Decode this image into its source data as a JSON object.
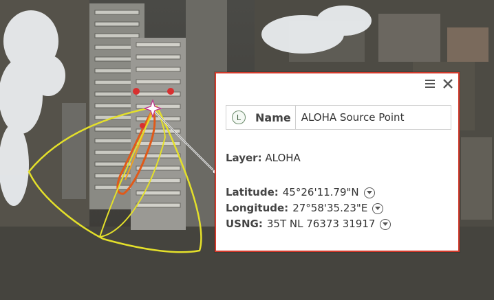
{
  "popup": {
    "menu_icon": "hamburger-menu-icon",
    "close_icon": "close-icon",
    "name_icon_letter": "L",
    "name_label": "Name",
    "name_value": "ALOHA Source Point",
    "layer_label": "Layer:",
    "layer_value": "ALOHA",
    "latitude_label": "Latitude:",
    "latitude_value": "45°26'11.79\"N",
    "longitude_label": "Longitude:",
    "longitude_value": "27°58'35.23\"E",
    "usng_label": "USNG:",
    "usng_value": "35T NL 76373 31917"
  },
  "colors": {
    "popup_border": "#d23a2b",
    "threat_zone_outer": "#e4e02a",
    "threat_zone_inner": "#e05a1a",
    "source_marker": "#d83030"
  }
}
